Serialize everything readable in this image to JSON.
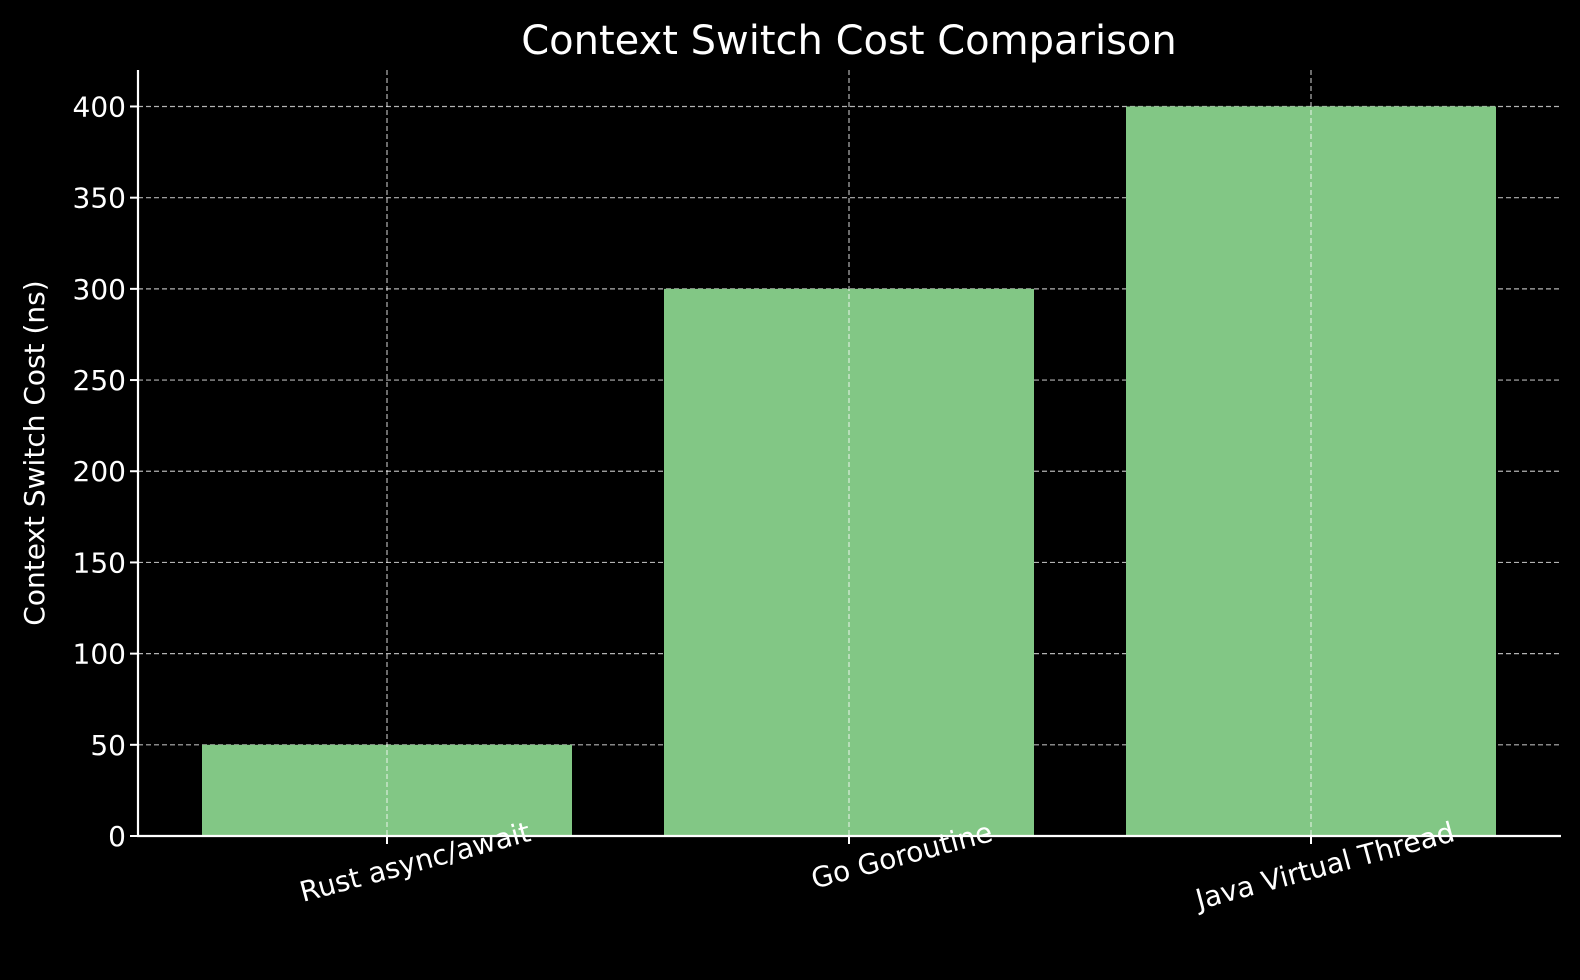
{
  "chart_data": {
    "type": "bar",
    "title": "Context Switch Cost Comparison",
    "xlabel": "",
    "ylabel": "Context Switch Cost (ns)",
    "categories": [
      "Rust async/await",
      "Go Goroutine",
      "Java Virtual Thread"
    ],
    "values": [
      50,
      300,
      400
    ],
    "ylim": [
      0,
      420
    ],
    "yticks": [
      0,
      50,
      100,
      150,
      200,
      250,
      300,
      350,
      400
    ],
    "grid": true,
    "bar_color": "#82c785",
    "background_color": "#000000",
    "text_color": "#ffffff",
    "x_tick_rotation": 15
  }
}
